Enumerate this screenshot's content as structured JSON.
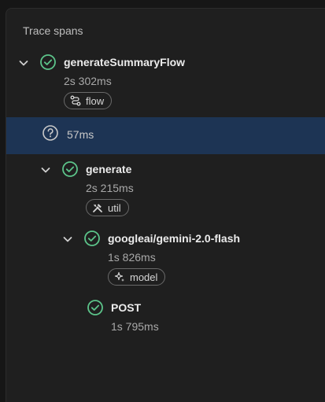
{
  "panel": {
    "title": "Trace spans"
  },
  "spans": [
    {
      "name": "generateSummaryFlow",
      "duration": "2s 302ms",
      "chip": "flow",
      "icon": "flow-icon",
      "status": "success"
    },
    {
      "name": "",
      "duration": "57ms",
      "chip": "",
      "icon": "help-circle-icon",
      "status": "unknown"
    },
    {
      "name": "generate",
      "duration": "2s 215ms",
      "chip": "util",
      "icon": "tools-icon",
      "status": "success"
    },
    {
      "name": "googleai/gemini-2.0-flash",
      "duration": "1s 826ms",
      "chip": "model",
      "icon": "sparkle-icon",
      "status": "success"
    },
    {
      "name": "POST",
      "duration": "1s 795ms",
      "chip": "",
      "icon": "",
      "status": "success"
    }
  ],
  "colors": {
    "success": "#5cc48a",
    "selected_row": "#1d3454",
    "background": "#1f1f1f"
  }
}
